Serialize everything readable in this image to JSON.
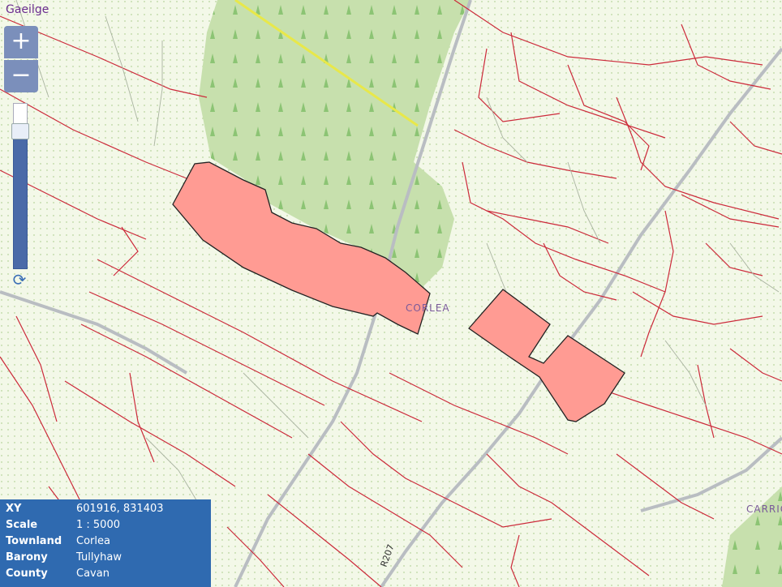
{
  "language_link": "Gaeilge",
  "zoom": {
    "in_label": "+",
    "out_label": "−"
  },
  "map_labels": {
    "townland": "CORLEA",
    "edge_label": "CARRIC",
    "road": "R207"
  },
  "info": {
    "rows": [
      {
        "key": "XY",
        "value": "601916, 831403"
      },
      {
        "key": "Scale",
        "value": "1 : 5000"
      },
      {
        "key": "Townland",
        "value": "Corlea"
      },
      {
        "key": "Barony",
        "value": "Tullyhaw"
      },
      {
        "key": "County",
        "value": "Cavan"
      }
    ]
  },
  "colors": {
    "parcel_fill": "#ff9b93",
    "forest": "#c7e0ad",
    "boundary": "#cc2a3a",
    "info_bg": "#2f6ab0"
  }
}
